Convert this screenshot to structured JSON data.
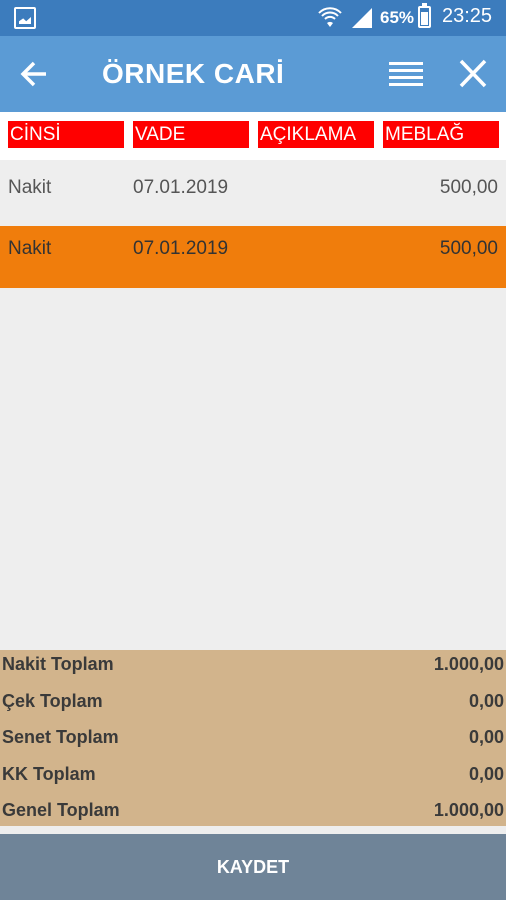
{
  "status_bar": {
    "battery_percent": "65%",
    "time": "23:25",
    "icons": [
      "gallery-icon",
      "wifi-icon",
      "signal-icon",
      "battery-icon"
    ]
  },
  "app_bar": {
    "title": "ÖRNEK CARİ",
    "icons": [
      "back-arrow-icon",
      "menu-lines-icon",
      "close-icon"
    ]
  },
  "table": {
    "headers": [
      "CİNSİ",
      "VADE",
      "AÇIKLAMA",
      "MEBLAĞ"
    ],
    "rows": [
      {
        "cinsi": "Nakit",
        "vade": "07.01.2019",
        "aciklama": "",
        "meblag": "500,00"
      },
      {
        "cinsi": "Nakit",
        "vade": "07.01.2019",
        "aciklama": "",
        "meblag": "500,00"
      }
    ]
  },
  "totals": [
    {
      "label": "Nakit Toplam",
      "value": "1.000,00"
    },
    {
      "label": "Çek Toplam",
      "value": "0,00"
    },
    {
      "label": "Senet Toplam",
      "value": "0,00"
    },
    {
      "label": "KK Toplam",
      "value": "0,00"
    },
    {
      "label": "Genel Toplam",
      "value": "1.000,00"
    }
  ],
  "save_button": {
    "label": "KAYDET"
  },
  "colors": {
    "status_bar": "#3c7cbd",
    "app_bar": "#5b9bd5",
    "header_cell": "#ff0000",
    "selected_row": "#f07d0c",
    "totals_bg": "#d2b48c",
    "save_button": "#6f8498"
  }
}
